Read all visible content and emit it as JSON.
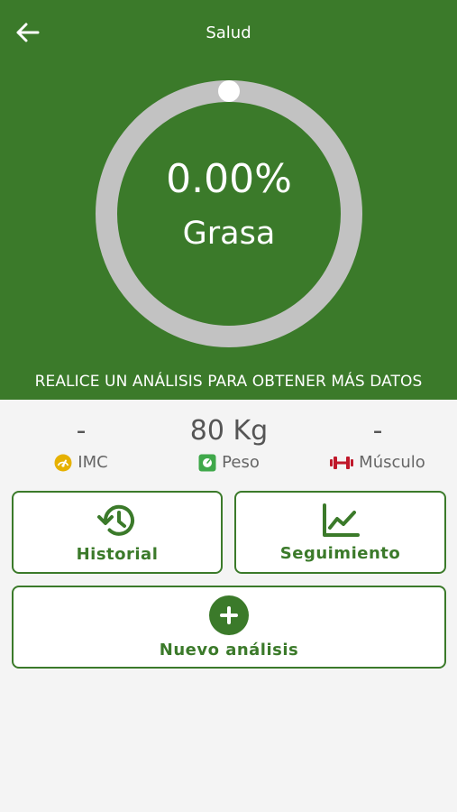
{
  "header": {
    "title": "Salud",
    "back_icon": "arrow-left-icon"
  },
  "gauge": {
    "value": "0.00%",
    "label": "Grasa",
    "progress_fraction": 0.0
  },
  "notice": "REALICE UN ANÁLISIS PARA OBTENER MÁS DATOS",
  "stats": [
    {
      "value": "-",
      "label": "IMC",
      "icon": "gauge-icon",
      "icon_color": "#e6b100"
    },
    {
      "value": "80 Kg",
      "label": "Peso",
      "icon": "scale-icon",
      "icon_color": "#3fa84a"
    },
    {
      "value": "-",
      "label": "Músculo",
      "icon": "dumbbell-icon",
      "icon_color": "#c0182a"
    }
  ],
  "actions": {
    "history_label": "Historial",
    "tracking_label": "Seguimiento",
    "new_analysis_label": "Nuevo análisis"
  },
  "colors": {
    "primary": "#3b7a2a",
    "ring_track": "#c2c2c2",
    "background": "#f4f4f4"
  }
}
